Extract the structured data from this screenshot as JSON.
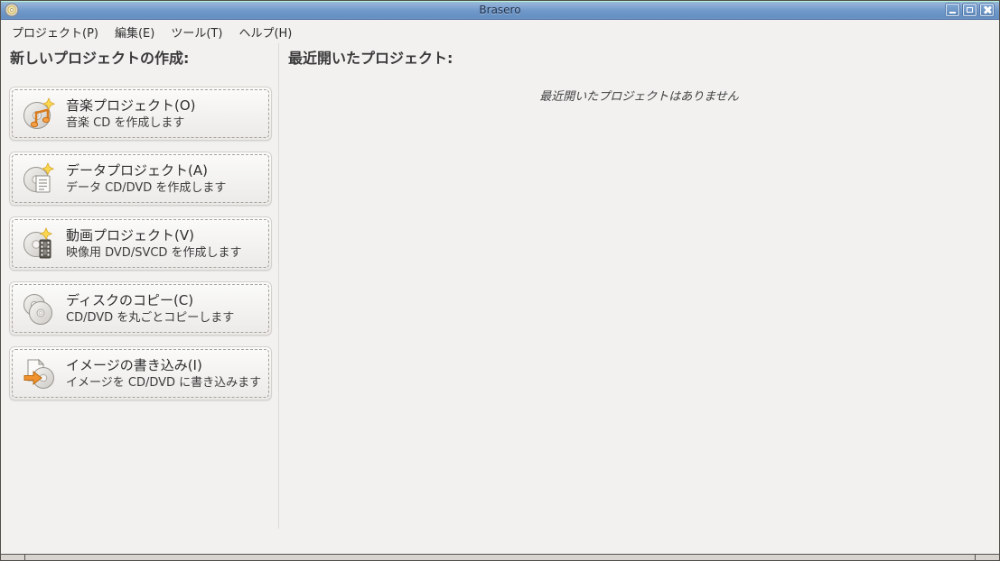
{
  "window": {
    "title": "Brasero",
    "controls": {
      "minimize": "minimize",
      "maximize": "maximize",
      "close": "close"
    }
  },
  "menu": {
    "items": [
      "プロジェクト(P)",
      "編集(E)",
      "ツール(T)",
      "ヘルプ(H)"
    ]
  },
  "left_panel": {
    "header": "新しいプロジェクトの作成:",
    "projects": [
      {
        "icon": "music-project-icon",
        "title": "音楽プロジェクト(O)",
        "subtitle": "音楽 CD を作成します"
      },
      {
        "icon": "data-project-icon",
        "title": "データプロジェクト(A)",
        "subtitle": "データ CD/DVD を作成します"
      },
      {
        "icon": "video-project-icon",
        "title": "動画プロジェクト(V)",
        "subtitle": "映像用 DVD/SVCD を作成します"
      },
      {
        "icon": "disc-copy-icon",
        "title": "ディスクのコピー(C)",
        "subtitle": "CD/DVD を丸ごとコピーします"
      },
      {
        "icon": "burn-image-icon",
        "title": "イメージの書き込み(I)",
        "subtitle": "イメージを CD/DVD に書き込みます"
      }
    ]
  },
  "right_panel": {
    "header": "最近開いたプロジェクト:",
    "empty_message": "最近開いたプロジェクトはありません"
  },
  "colors": {
    "titlebar_blue": "#7099ca",
    "background": "#f2f1f0",
    "accent_orange": "#ef9334",
    "star_yellow": "#fbd84e"
  }
}
